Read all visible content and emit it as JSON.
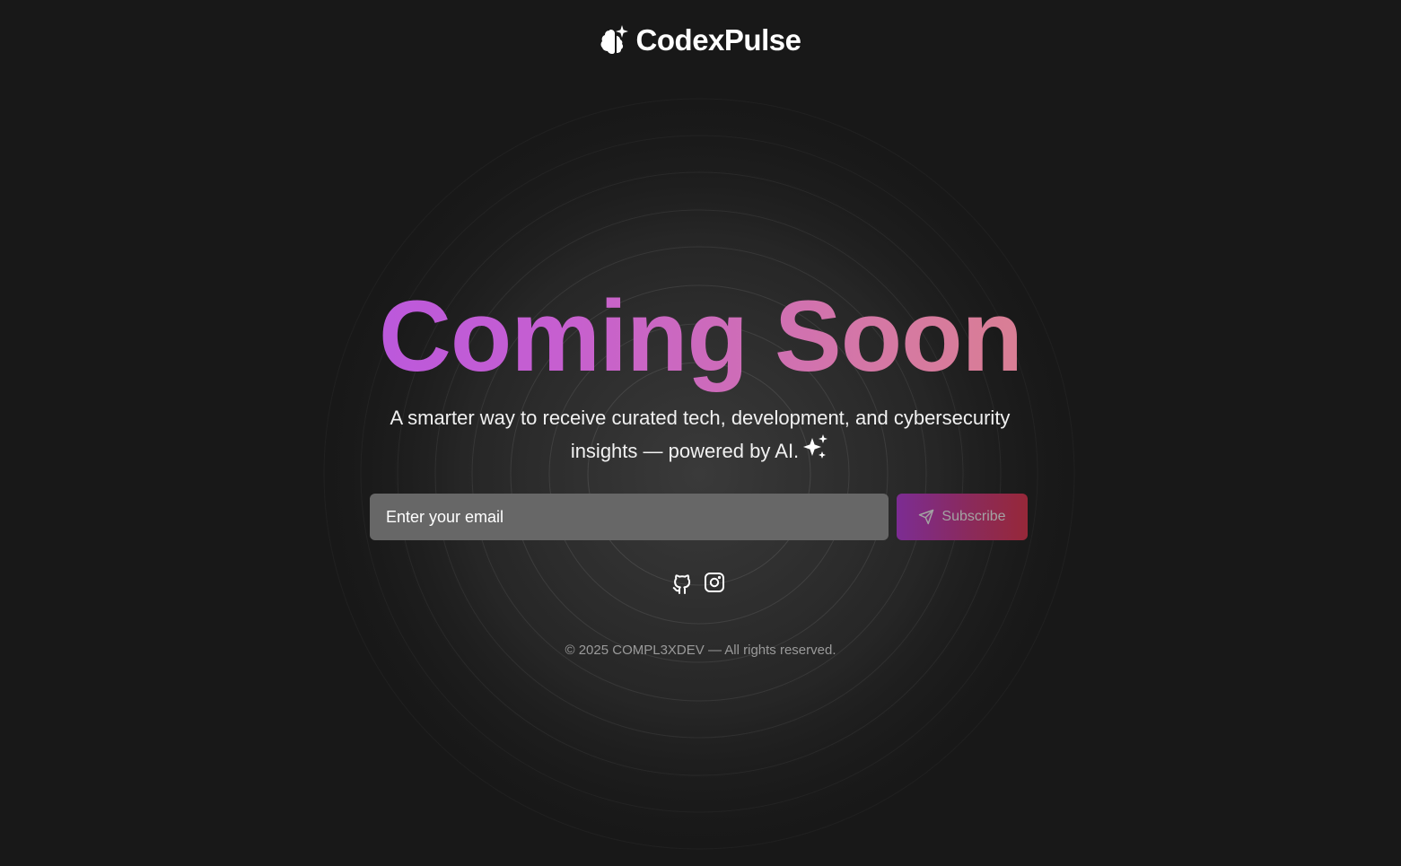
{
  "brand": {
    "name": "CodexPulse",
    "logo_icon": "brain-sparkle-icon"
  },
  "hero": {
    "title": "Coming Soon",
    "subtitle": "A smarter way to receive curated tech, development, and cybersecurity insights — powered by AI.",
    "subtitle_icon": "sparkles-icon",
    "title_gradient": [
      "#a64bf4",
      "#c65fd0",
      "#d67aa0",
      "#e58c6c"
    ]
  },
  "subscribe": {
    "email_placeholder": "Enter your email",
    "email_value": "",
    "button_label": "Subscribe",
    "button_icon": "send-icon",
    "button_gradient": [
      "#7c2c93",
      "#972839"
    ]
  },
  "social": {
    "links": [
      {
        "icon": "github-icon",
        "label": "GitHub"
      },
      {
        "icon": "instagram-icon",
        "label": "Instagram"
      }
    ]
  },
  "footer": {
    "text": "© 2025 COMPL3XDEV — All rights reserved."
  },
  "colors": {
    "background": "#181818",
    "input_background": "#676767",
    "footer_text": "#9a9a9a"
  }
}
